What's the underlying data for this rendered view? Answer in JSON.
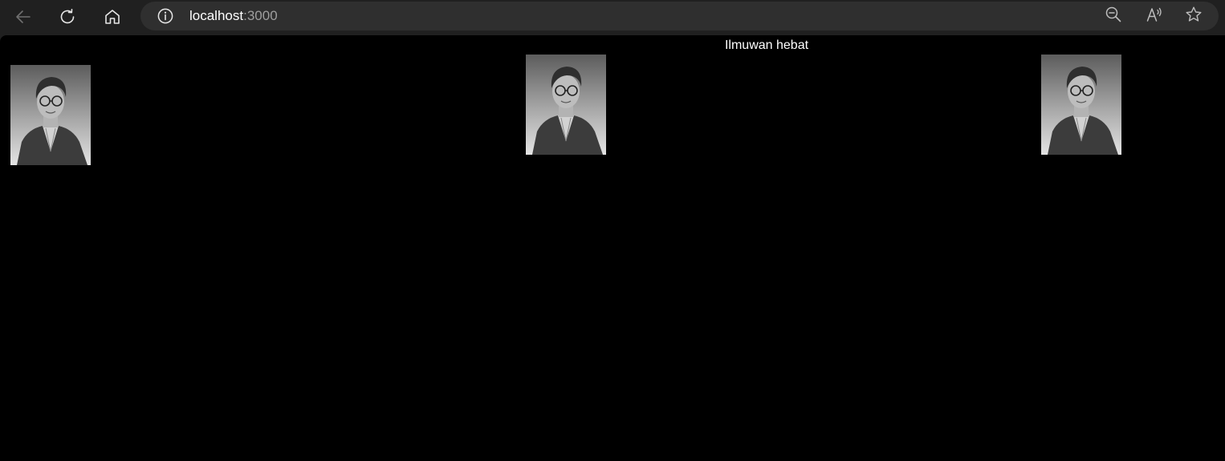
{
  "browser": {
    "url_host": "localhost",
    "url_port": ":3000",
    "icons": {
      "back": "back-arrow-icon",
      "reload": "reload-icon",
      "home": "home-icon",
      "site_info": "info-icon",
      "zoom": "zoom-out-icon",
      "read_aloud": "read-aloud-icon",
      "favorite": "star-icon"
    }
  },
  "page": {
    "heading": "Ilmuwan hebat",
    "background_color": "#000000",
    "text_color": "#ffffff",
    "images": [
      {
        "kind": "black-and-white portrait photo"
      },
      {
        "kind": "black-and-white portrait photo"
      },
      {
        "kind": "black-and-white portrait photo"
      }
    ]
  }
}
